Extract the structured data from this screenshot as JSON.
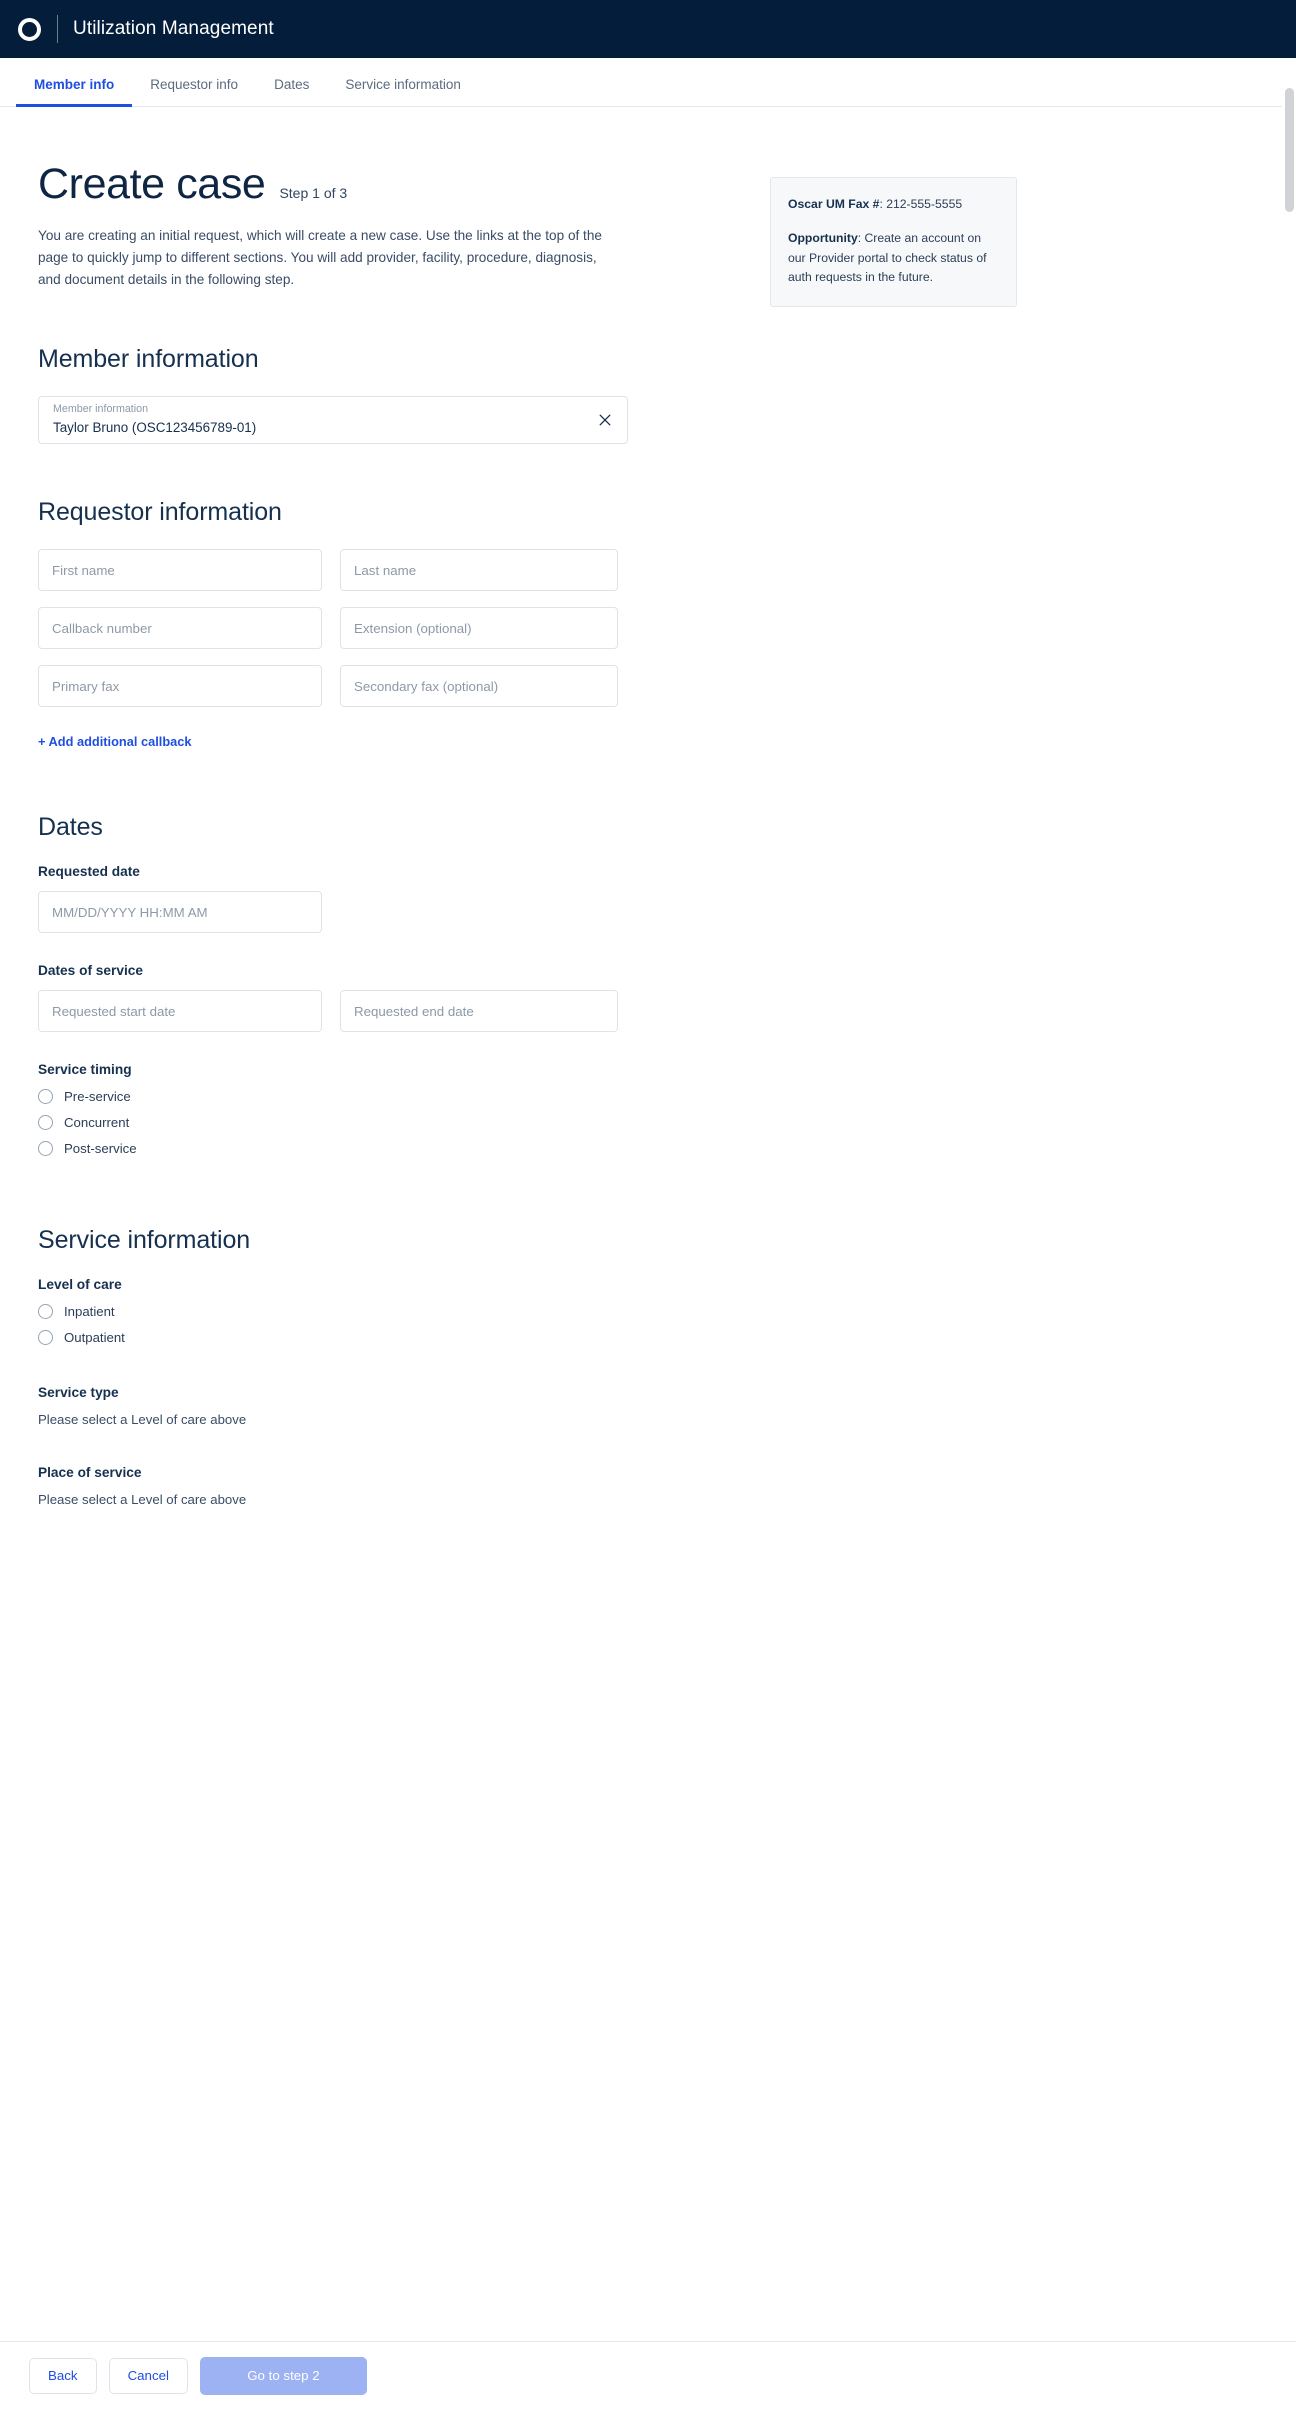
{
  "header": {
    "logo_icon": "oscar-ring-logo",
    "app_title": "Utilization Management"
  },
  "tabs": [
    {
      "label": "Member info",
      "active": true
    },
    {
      "label": "Requestor info",
      "active": false
    },
    {
      "label": "Dates",
      "active": false
    },
    {
      "label": "Service information",
      "active": false
    }
  ],
  "page": {
    "title": "Create case",
    "step": "Step 1 of 3",
    "intro": "You are creating an initial request, which will create a new case. Use the links at the top of the page to quickly jump to different sections. You will add provider, facility, procedure, diagnosis, and document details in the following step."
  },
  "info_card": {
    "fax_label": "Oscar UM Fax #",
    "fax_value": ": 212-555-5555",
    "opportunity_label": "Opportunity",
    "opportunity_value": ": Create an account on our Provider portal to check status of auth requests in the future."
  },
  "member_information": {
    "heading": "Member information",
    "combo_label": "Member information",
    "combo_value": "Taylor Bruno (OSC123456789-01)",
    "clear_icon": "close-icon"
  },
  "requestor_information": {
    "heading": "Requestor information",
    "fields": [
      {
        "name": "first-name",
        "placeholder": "First name",
        "value": ""
      },
      {
        "name": "last-name",
        "placeholder": "Last name",
        "value": ""
      },
      {
        "name": "callback-number",
        "placeholder": "Callback number",
        "value": ""
      },
      {
        "name": "extension",
        "placeholder": "Extension (optional)",
        "value": ""
      },
      {
        "name": "primary-fax",
        "placeholder": "Primary fax",
        "value": ""
      },
      {
        "name": "secondary-fax",
        "placeholder": "Secondary fax (optional)",
        "value": ""
      }
    ],
    "add_callback_link": "+ Add additional callback"
  },
  "dates": {
    "heading": "Dates",
    "requested_date_label": "Requested date",
    "requested_date_placeholder": "MM/DD/YYYY HH:MM AM",
    "dates_of_service_label": "Dates of service",
    "start_placeholder": "Requested start date",
    "end_placeholder": "Requested end date",
    "service_timing_label": "Service timing",
    "service_timing_options": [
      "Pre-service",
      "Concurrent",
      "Post-service"
    ]
  },
  "service_information": {
    "heading": "Service information",
    "level_of_care_label": "Level of care",
    "level_of_care_options": [
      "Inpatient",
      "Outpatient"
    ],
    "service_type_label": "Service type",
    "service_type_hint": "Please select a Level of care above",
    "place_of_service_label": "Place of service",
    "place_of_service_hint": "Please select a Level of care above"
  },
  "footer": {
    "back_label": "Back",
    "cancel_label": "Cancel",
    "primary_label": "Go to step 2"
  },
  "colors": {
    "header_bg": "#041d3b",
    "accent_blue": "#1f4fe0",
    "primary_disabled": "#9db2f2",
    "text_dark": "#16304f",
    "card_bg": "#f7f8f9"
  }
}
